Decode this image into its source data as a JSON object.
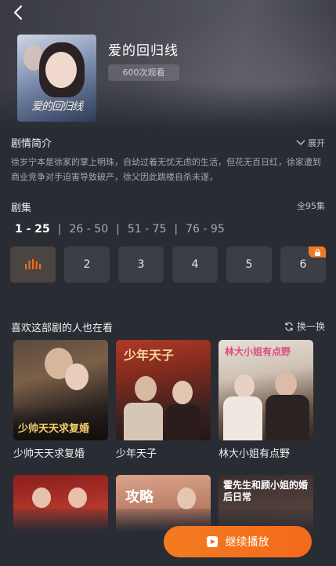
{
  "header": {
    "title": "爱的回归线",
    "views": "600次观看",
    "poster_caption": "爱的回归线"
  },
  "synopsis": {
    "heading": "剧情简介",
    "expand_label": "展开",
    "text": "徐岁宁本是徐家的掌上明珠，自幼过着无忧无虑的生活，但花无百日红，徐家遭到商业竞争对手迫害导致破产，徐父因此跳楼自杀未遂，"
  },
  "episodes": {
    "heading": "剧集",
    "total": "全95集",
    "ranges": [
      "1 - 25",
      "26 - 50",
      "51 - 75",
      "76 - 95"
    ],
    "active_range": 0,
    "items": [
      "",
      "2",
      "3",
      "4",
      "5",
      "6"
    ],
    "playing_index": 0,
    "locked_index": 5
  },
  "recommend": {
    "heading": "喜欢这部剧的人也在看",
    "refresh_label": "换一换",
    "cards": [
      {
        "title": "少帅天天求复婚",
        "poster_text": "少帅天天求复婚"
      },
      {
        "title": "少年天子",
        "poster_text": "少年天子"
      },
      {
        "title": "林大小姐有点野",
        "poster_text": "林大小姐有点野"
      },
      {
        "title": "",
        "poster_text": ""
      },
      {
        "title": "",
        "poster_text": "攻略"
      },
      {
        "title": "",
        "poster_text": "霍先生和顾小姐的婚后日常"
      }
    ]
  },
  "cta": {
    "label": "继续播放"
  },
  "colors": {
    "accent": "#f26a1b",
    "background": "#2a2c33",
    "tile": "#3c3e46"
  }
}
